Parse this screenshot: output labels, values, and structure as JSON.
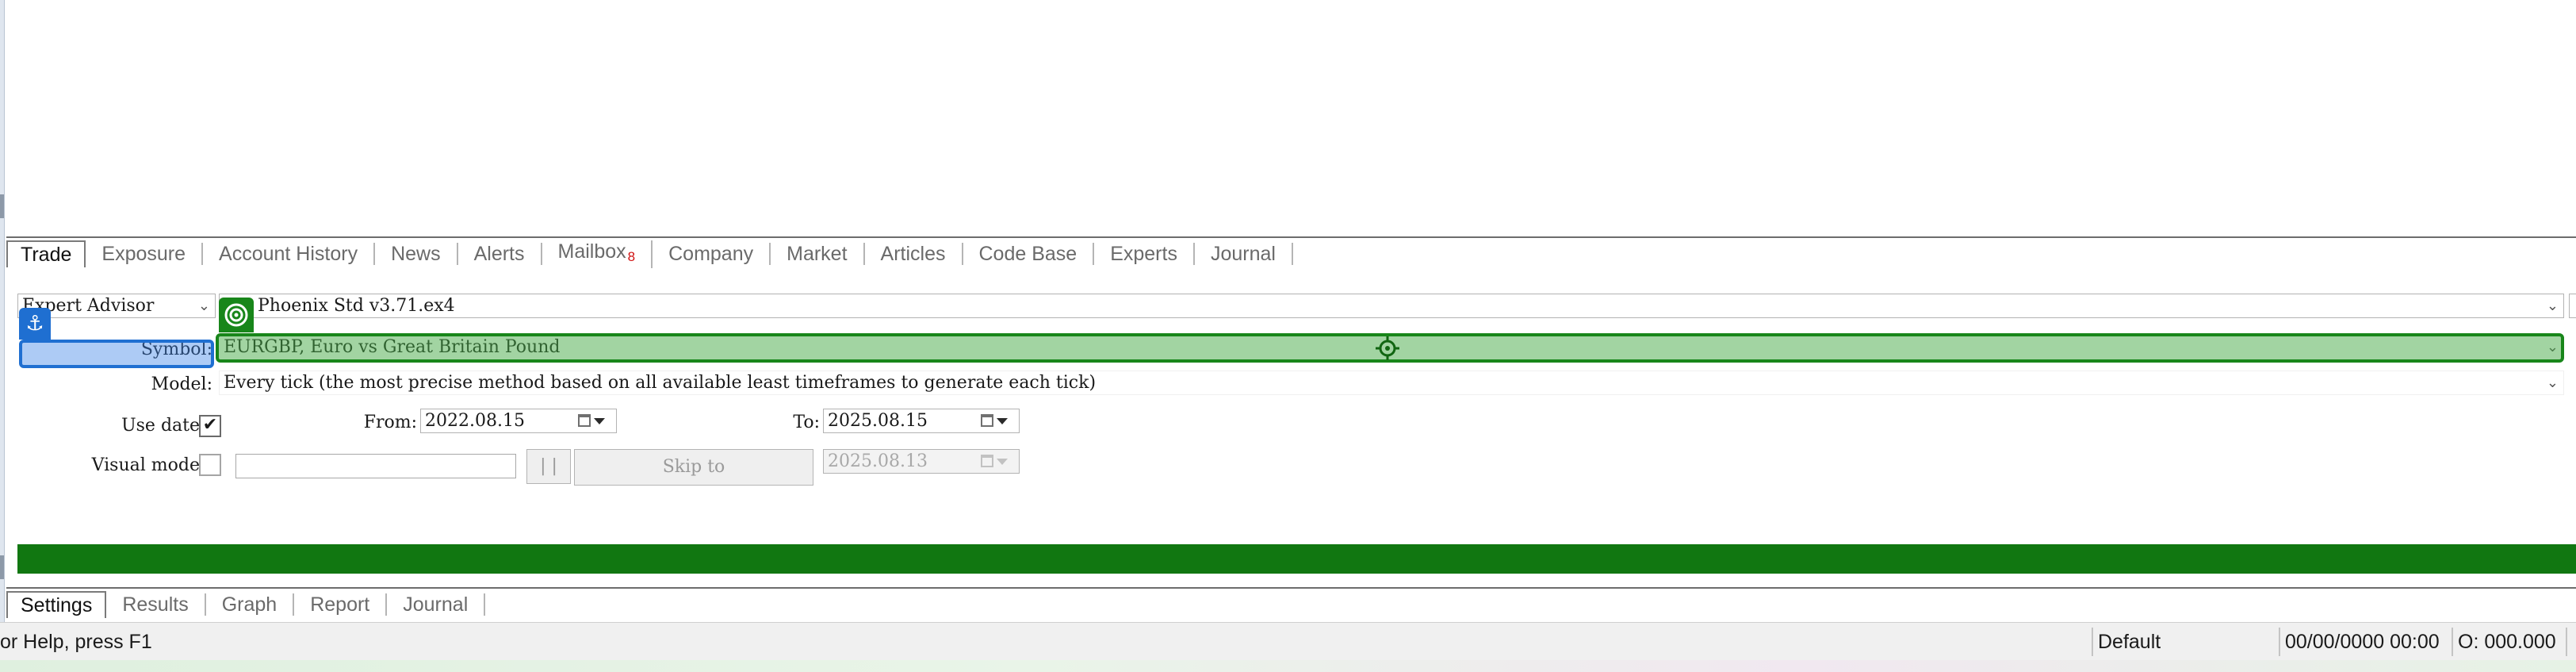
{
  "terminal_tabs": [
    {
      "label": "Trade",
      "active": true
    },
    {
      "label": "Exposure"
    },
    {
      "label": "Account History"
    },
    {
      "label": "News"
    },
    {
      "label": "Alerts"
    },
    {
      "label": "Mailbox",
      "badge": "8"
    },
    {
      "label": "Company"
    },
    {
      "label": "Market"
    },
    {
      "label": "Articles"
    },
    {
      "label": "Code Base"
    },
    {
      "label": "Experts"
    },
    {
      "label": "Journal"
    }
  ],
  "settings": {
    "type_select": "Expert Advisor",
    "expert_file": "Phoenix Std v3.71.ex4",
    "symbol_label": "Symbol:",
    "symbol_value": "EURGBP, Euro vs Great Britain Pound",
    "model_label": "Model:",
    "model_value": "Every tick (the most precise method based on all available least timeframes to generate each tick)",
    "use_date_label": "Use date",
    "use_date_checked": true,
    "from_label": "From:",
    "from_date": "2022.08.15",
    "to_label": "To:",
    "to_date": "2025.08.15",
    "visual_mode_label": "Visual mode",
    "visual_mode_checked": false,
    "pause_label": "| |",
    "skip_to_label": "Skip to",
    "skip_to_date": "2025.08.13"
  },
  "progress": {
    "fraction": 1.0,
    "color": "#117711"
  },
  "tester_tabs": [
    {
      "label": "Settings",
      "active": true
    },
    {
      "label": "Results"
    },
    {
      "label": "Graph"
    },
    {
      "label": "Report"
    },
    {
      "label": "Journal"
    }
  ],
  "status_bar": {
    "help_text": "or Help, press F1",
    "profile": "Default",
    "datetime": "00/00/0000 00:00",
    "open_value": "O: 000.000"
  },
  "colors": {
    "highlight_blue": "#1f6fd1",
    "highlight_green": "#18861a"
  }
}
